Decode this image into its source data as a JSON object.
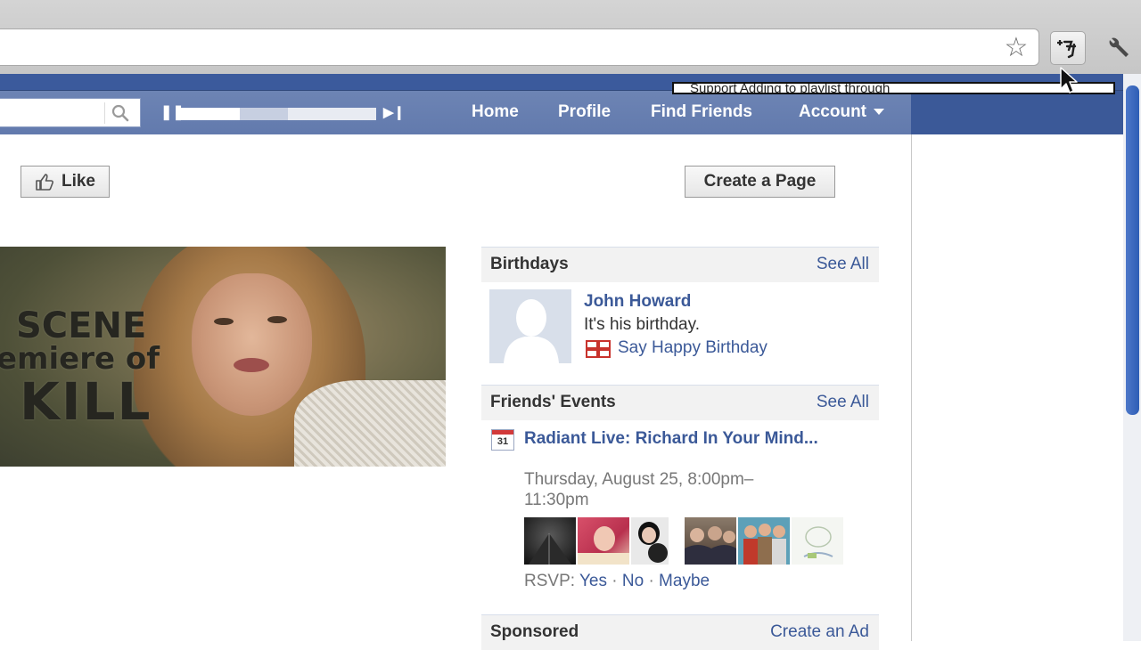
{
  "browser": {
    "tooltip_text": "Support Adding to playlist through"
  },
  "nav": {
    "items": [
      {
        "label": "Home"
      },
      {
        "label": "Profile"
      },
      {
        "label": "Find Friends"
      },
      {
        "label": "Account"
      }
    ]
  },
  "player": {
    "progress_fraction": 0.55
  },
  "page": {
    "like_label": "Like",
    "create_page_label": "Create a Page"
  },
  "video": {
    "overlay_lines": [
      "SCENE",
      "emiere of",
      "KILL"
    ]
  },
  "birthdays": {
    "title": "Birthdays",
    "see_all": "See All",
    "name": "John Howard",
    "message": "It's his birthday.",
    "action": "Say Happy Birthday"
  },
  "events": {
    "title": "Friends' Events",
    "see_all": "See All",
    "calendar_day": "31",
    "event_title": "Radiant Live: Richard In Your Mind...",
    "event_time": "Thursday, August 25, 8:00pm–11:30pm",
    "rsvp_label": "RSVP:",
    "rsvp_options": [
      "Yes",
      "No",
      "Maybe"
    ],
    "separator": "·"
  },
  "sponsored": {
    "title": "Sponsored",
    "link": "Create an Ad"
  },
  "colors": {
    "facebook_blue": "#3b5998",
    "nav_strip": "#6d84b4",
    "link": "#3b5998"
  }
}
